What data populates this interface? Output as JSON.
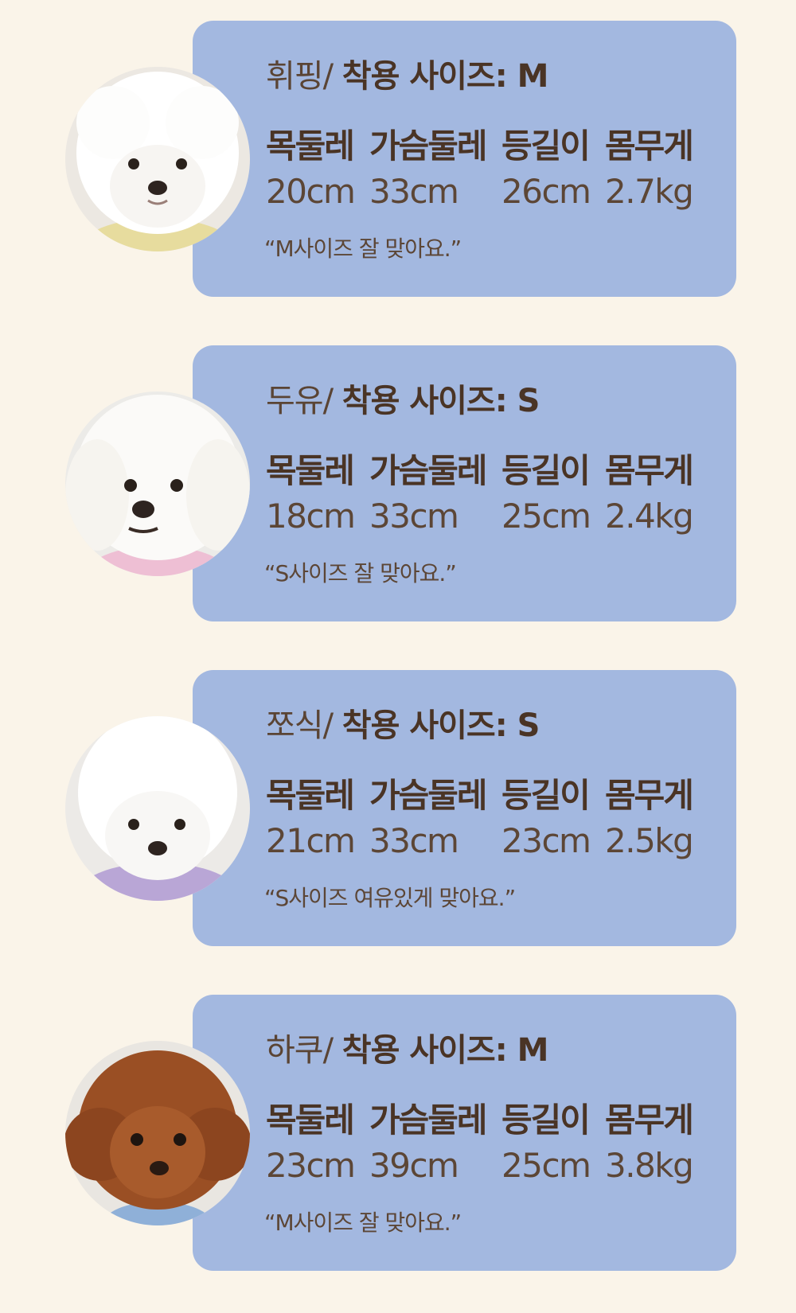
{
  "headers": {
    "neck": "목둘레",
    "chest": "가슴둘레",
    "back": "등길이",
    "weight": "몸무게"
  },
  "dogs": [
    {
      "name": "휘핑/",
      "size_label": "착용 사이즈: M",
      "neck": "20cm",
      "chest": "33cm",
      "back": "26cm",
      "weight": "2.7kg",
      "quote": "“M사이즈 잘 맞아요.”",
      "photo": "white-bichon-yellow-sweater"
    },
    {
      "name": "두유/",
      "size_label": "착용 사이즈: S",
      "neck": "18cm",
      "chest": "33cm",
      "back": "25cm",
      "weight": "2.4kg",
      "quote": "“S사이즈 잘 맞아요.”",
      "photo": "white-maltese-pink-sweater"
    },
    {
      "name": "쪼식/",
      "size_label": "착용 사이즈: S",
      "neck": "21cm",
      "chest": "33cm",
      "back": "23cm",
      "weight": "2.5kg",
      "quote": "“S사이즈 여유있게 맞아요.”",
      "photo": "white-bichon-purple-sweater"
    },
    {
      "name": "하쿠/",
      "size_label": "착용 사이즈: M",
      "neck": "23cm",
      "chest": "39cm",
      "back": "25cm",
      "weight": "3.8kg",
      "quote": "“M사이즈 잘 맞아요.”",
      "photo": "brown-poodle-blue-collar"
    }
  ],
  "colors": {
    "background": "#faf4e9",
    "card": "#a3b8e0",
    "text": "#4a3425"
  }
}
